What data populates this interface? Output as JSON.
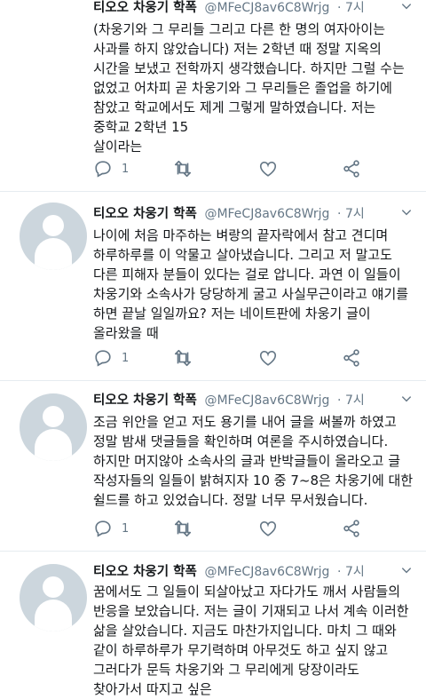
{
  "tweets": [
    {
      "name": "티오오 차웅기 학폭",
      "handle": "@MFeCJ8av6C8Wrjg",
      "time": "· 7시",
      "lines": [
        "(차웅기와 그 무리들 그리고 다른 한 명의 여자아이는",
        "사과를 하지 않았습니다) 저는 2학년 때 정말 지옥의",
        "시간을 보냈고 전학까지 생각했습니다. 하지만 그럴 수는",
        "없었고 어차피 곧 차웅기와 그 무리들은 졸업을 하기에",
        "참았고 학교에서도 제게 그렇게 말하였습니다. 저는",
        "중학교 2학년 15",
        "살이라는"
      ],
      "reply_count": "1"
    },
    {
      "name": "티오오 차웅기 학폭",
      "handle": "@MFeCJ8av6C8Wrjg",
      "time": "· 7시",
      "lines": [
        "나이에 처음 마주하는 벼랑의 끝자락에서 참고 견디며",
        "하루하루를 이 악물고 살아냈습니다. 그리고 저 말고도",
        "다른 피해자 분들이 있다는 걸로 압니다. 과연 이 일들이",
        "차웅기와 소속사가 당당하게 굴고 사실무근이라고 얘기를",
        "하면 끝날 일일까요? 저는 네이트판에 차웅기 글이",
        "올라왔을 때"
      ],
      "reply_count": "1"
    },
    {
      "name": "티오오 차웅기 학폭",
      "handle": "@MFeCJ8av6C8Wrjg",
      "time": "· 7시",
      "lines": [
        "조금 위안을 얻고 저도 용기를 내어 글을 써볼까 하였고",
        "정말 밤새 댓글들을 확인하며 여론을 주시하였습니다.",
        "하지만 머지않아 소속사의 글과 반박글들이 올라오고 글",
        "작성자들의 일들이 밝혀지자 10 중 7~8은 차웅기에 대한",
        "쉴드를 하고 있었습니다. 정말 너무 무서웠습니다."
      ],
      "reply_count": "1"
    },
    {
      "name": "티오오 차웅기 학폭",
      "handle": "@MFeCJ8av6C8Wrjg",
      "time": "· 7시",
      "lines": [
        "꿈에서도 그 일들이 되살아났고 자다가도 깨서 사람들의",
        "반응을 보았습니다. 저는 글이 기재되고 나서 계속 이러한",
        "삶을 살았습니다. 지금도 마찬가지입니다. 마치 그 때와",
        "같이 하루하루가 무기력하며 아무것도 하고 싶지 않고",
        "그러다가 문득 차웅기와 그 무리에게 당장이라도",
        "찾아가서 따지고 싶은"
      ]
    }
  ],
  "icons": {
    "reply": "speech-bubble-icon",
    "retweet": "retweet-icon",
    "like": "heart-icon",
    "share": "share-icon",
    "caret": "chevron-down-icon"
  },
  "colors": {
    "text": "#14171a",
    "secondary": "#657786",
    "avatar_bg": "#ccd6dd",
    "divider": "#e6ecf0"
  }
}
